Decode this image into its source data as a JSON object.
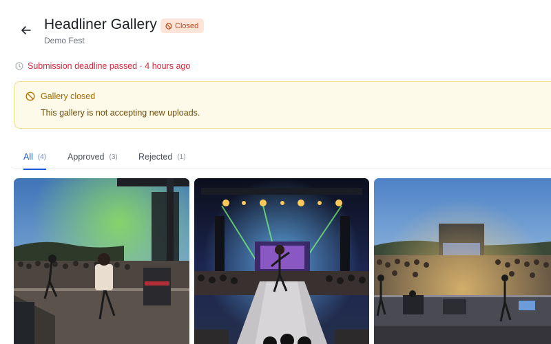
{
  "header": {
    "title": "Headliner Gallery",
    "subtitle": "Demo Fest",
    "status_badge": "Closed"
  },
  "deadline": {
    "text": "Submission deadline passed",
    "separator": "·",
    "relative_time": "4 hours ago"
  },
  "alert": {
    "title": "Gallery closed",
    "message": "This gallery is not accepting new uploads."
  },
  "tabs": [
    {
      "label": "All",
      "count": "(4)",
      "active": true
    },
    {
      "label": "Approved",
      "count": "(3)",
      "active": false
    },
    {
      "label": "Rejected",
      "count": "(1)",
      "active": false
    }
  ],
  "photos": [
    {
      "description_icon": "band-on-stage-photo",
      "scene": "dusk sky, guitarist and singer with crowd"
    },
    {
      "description_icon": "singer-on-catwalk-photo",
      "scene": "lit stage truss, singer on runway"
    },
    {
      "description_icon": "festival-crowd-photo",
      "scene": "wide stage view, large crowd, golden lights"
    }
  ],
  "colors": {
    "accent": "#1a57d8",
    "danger": "#d9273a",
    "badge_bg": "#fde4d8",
    "badge_text": "#b94a1c",
    "alert_bg": "#fefaea",
    "alert_border": "#f1dd8c",
    "alert_title": "#a56a00"
  }
}
